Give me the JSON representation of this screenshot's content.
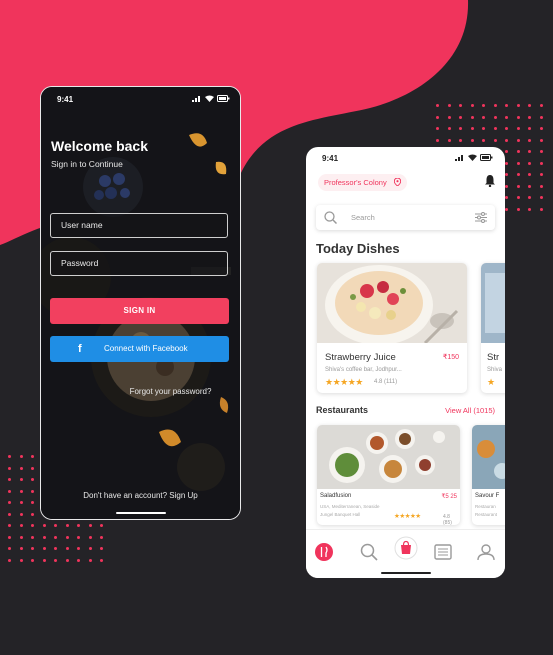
{
  "colors": {
    "accent": "#f0345c",
    "background": "#242327",
    "facebook": "#1f8ee5",
    "star": "#f5a623"
  },
  "login": {
    "time": "9:41",
    "title": "Welcome back",
    "subtitle": "Sign in to Continue",
    "username_placeholder": "User name",
    "password_placeholder": "Password",
    "signin_label": "SIGN IN",
    "facebook_icon": "f",
    "facebook_label": "Connect with Facebook",
    "forgot_label": "Forgot your password?",
    "signup_label": "Don't have an account? Sign Up"
  },
  "home": {
    "time": "9:41",
    "location": "Professor's Colony",
    "search_placeholder": "Search",
    "today_title": "Today Dishes",
    "dish": {
      "name": "Strawberry Juice",
      "price": "₹150",
      "desc": "Shiva's coffee bar, Jodhpur...",
      "stars": "★★★★★",
      "rating": "4.8 (111)"
    },
    "dish2": {
      "name": "Str",
      "desc": "Shiva",
      "stars": "★"
    },
    "restaurants_title": "Restaurants",
    "view_all": "View All (1015)",
    "restaurant": {
      "name": "Saladfusion",
      "price": "₹5 25",
      "line1": "USA, Mediterranean, Seaside",
      "line2": "Jungel Banquet Hall",
      "stars": "★★★★★",
      "rating": "4.8 (85)"
    },
    "restaurant2": {
      "name": "Savour F",
      "line1": "Restauran",
      "line2": "Restaurant"
    },
    "tabs": [
      "dishes-icon",
      "search-icon",
      "bag-icon",
      "list-icon",
      "profile-icon"
    ]
  }
}
